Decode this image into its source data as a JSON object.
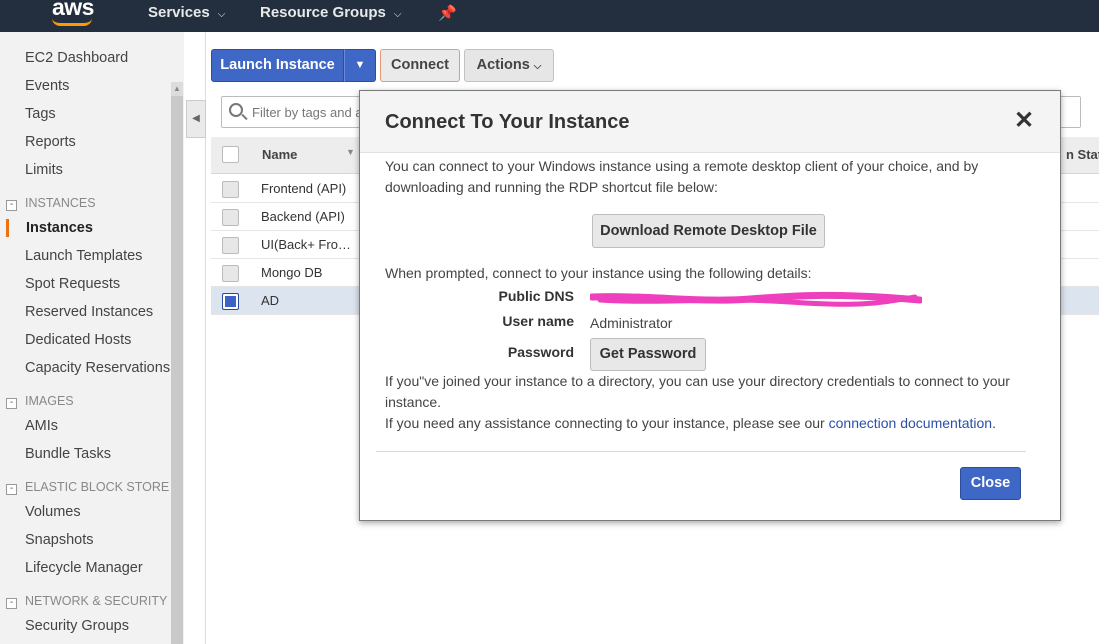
{
  "topnav": {
    "logo": "aws",
    "services_label": "Services",
    "resource_groups_label": "Resource Groups",
    "chevron": "⌄",
    "pin_icon": "pin-icon"
  },
  "sidebar": {
    "items": [
      {
        "label": "EC2 Dashboard"
      },
      {
        "label": "Events"
      },
      {
        "label": "Tags"
      },
      {
        "label": "Reports"
      },
      {
        "label": "Limits"
      }
    ],
    "sections": [
      {
        "label": "INSTANCES",
        "items": [
          "Instances",
          "Launch Templates",
          "Spot Requests",
          "Reserved Instances",
          "Dedicated Hosts",
          "Capacity Reservations"
        ]
      },
      {
        "label": "IMAGES",
        "items": [
          "AMIs",
          "Bundle Tasks"
        ]
      },
      {
        "label": "ELASTIC BLOCK STORE",
        "items": [
          "Volumes",
          "Snapshots",
          "Lifecycle Manager"
        ]
      },
      {
        "label": "NETWORK & SECURITY",
        "items": [
          "Security Groups"
        ]
      }
    ],
    "active_item": "Instances",
    "active_color": "#ec7211"
  },
  "toolbar": {
    "launch_label": "Launch Instance",
    "connect_label": "Connect",
    "actions_label": "Actions"
  },
  "filter": {
    "placeholder": "Filter by tags and a"
  },
  "table": {
    "columns": [
      "Name",
      "n Statu"
    ],
    "rows": [
      {
        "name": "Frontend (API)",
        "selected": false
      },
      {
        "name": "Backend (API)",
        "selected": false
      },
      {
        "name": "UI(Back+ Fro…",
        "selected": false
      },
      {
        "name": "Mongo DB",
        "selected": false
      },
      {
        "name": "AD",
        "selected": true
      }
    ]
  },
  "modal": {
    "title": "Connect To Your Instance",
    "close_x": "✕",
    "intro": "You can connect to your Windows instance using a remote desktop client of your choice, and by downloading and running the RDP shortcut file below:",
    "download_label": "Download Remote Desktop File",
    "prompt_text": "When prompted, connect to your instance using the following details:",
    "public_dns_label": "Public DNS",
    "public_dns_value": "",
    "username_label": "User name",
    "username_value": "Administrator",
    "password_label": "Password",
    "get_password_label": "Get Password",
    "directory_text": "If you\"ve joined your instance to a directory, you can use your directory credentials to connect to your instance.",
    "assistance_text": "If you need any assistance connecting to your instance, please see our ",
    "doc_link": "connection documentation",
    "period": ".",
    "close_label": "Close",
    "redaction_color": "#ee3fbd"
  }
}
